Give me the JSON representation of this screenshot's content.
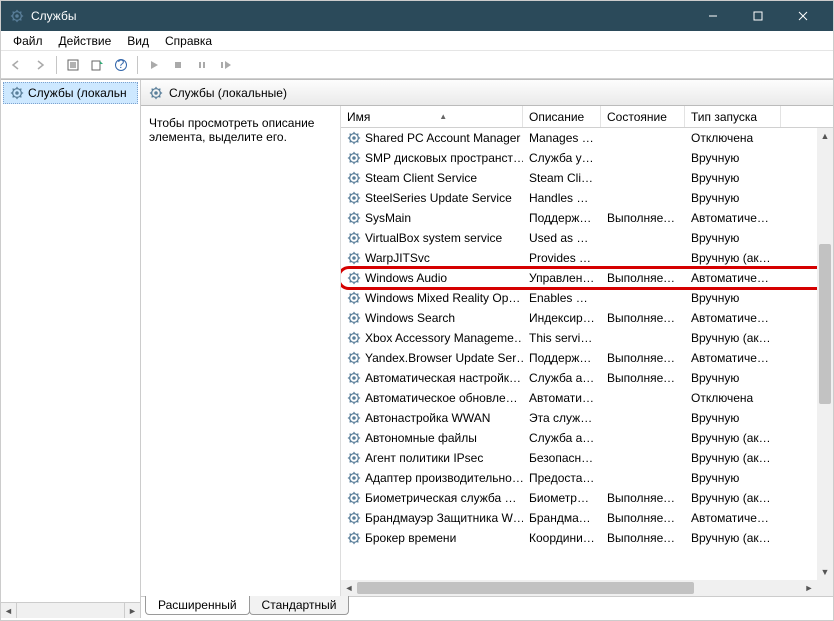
{
  "window": {
    "title": "Службы"
  },
  "menu": {
    "file": "Файл",
    "action": "Действие",
    "view": "Вид",
    "help": "Справка"
  },
  "tree": {
    "root": "Службы (локальн"
  },
  "header": {
    "title": "Службы (локальные)"
  },
  "desc": {
    "text": "Чтобы просмотреть описание элемента, выделите его."
  },
  "columns": {
    "name": "Имя",
    "description": "Описание",
    "status": "Состояние",
    "startup": "Тип запуска"
  },
  "services": [
    {
      "name": "Shared PC Account Manager",
      "desc": "Manages p…",
      "status": "",
      "startup": "Отключена"
    },
    {
      "name": "SMP дисковых пространст…",
      "desc": "Служба уз…",
      "status": "",
      "startup": "Вручную"
    },
    {
      "name": "Steam Client Service",
      "desc": "Steam Clie…",
      "status": "",
      "startup": "Вручную"
    },
    {
      "name": "SteelSeries Update Service",
      "desc": "Handles u…",
      "status": "",
      "startup": "Вручную"
    },
    {
      "name": "SysMain",
      "desc": "Поддержи…",
      "status": "Выполняется",
      "startup": "Автоматиче…"
    },
    {
      "name": "VirtualBox system service",
      "desc": "Used as a …",
      "status": "",
      "startup": "Вручную"
    },
    {
      "name": "WarpJITSvc",
      "desc": "Provides a …",
      "status": "",
      "startup": "Вручную (ак…"
    },
    {
      "name": "Windows Audio",
      "desc": "Управлен…",
      "status": "Выполняется",
      "startup": "Автоматиче…",
      "highlight": true
    },
    {
      "name": "Windows Mixed Reality Op…",
      "desc": "Enables Mi…",
      "status": "",
      "startup": "Вручную"
    },
    {
      "name": "Windows Search",
      "desc": "Индексир…",
      "status": "Выполняется",
      "startup": "Автоматиче…"
    },
    {
      "name": "Xbox Accessory Manageme…",
      "desc": "This servic…",
      "status": "",
      "startup": "Вручную (ак…"
    },
    {
      "name": "Yandex.Browser Update Ser…",
      "desc": "Поддержи…",
      "status": "Выполняется",
      "startup": "Автоматиче…"
    },
    {
      "name": "Автоматическая настройк…",
      "desc": "Служба ав…",
      "status": "Выполняется",
      "startup": "Вручную"
    },
    {
      "name": "Автоматическое обновле…",
      "desc": "Автомати…",
      "status": "",
      "startup": "Отключена"
    },
    {
      "name": "Автонастройка WWAN",
      "desc": "Эта служб…",
      "status": "",
      "startup": "Вручную"
    },
    {
      "name": "Автономные файлы",
      "desc": "Служба ав…",
      "status": "",
      "startup": "Вручную (ак…"
    },
    {
      "name": "Агент политики IPsec",
      "desc": "Безопасно…",
      "status": "",
      "startup": "Вручную (ак…"
    },
    {
      "name": "Адаптер производительно…",
      "desc": "Предостав…",
      "status": "",
      "startup": "Вручную"
    },
    {
      "name": "Биометрическая служба …",
      "desc": "Биометри…",
      "status": "Выполняется",
      "startup": "Вручную (ак…"
    },
    {
      "name": "Брандмауэр Защитника W…",
      "desc": "Брандмау…",
      "status": "Выполняется",
      "startup": "Автоматиче…"
    },
    {
      "name": "Брокер времени",
      "desc": "Координи…",
      "status": "Выполняется",
      "startup": "Вручную (ак…"
    }
  ],
  "tabs": {
    "extended": "Расширенный",
    "standard": "Стандартный"
  }
}
